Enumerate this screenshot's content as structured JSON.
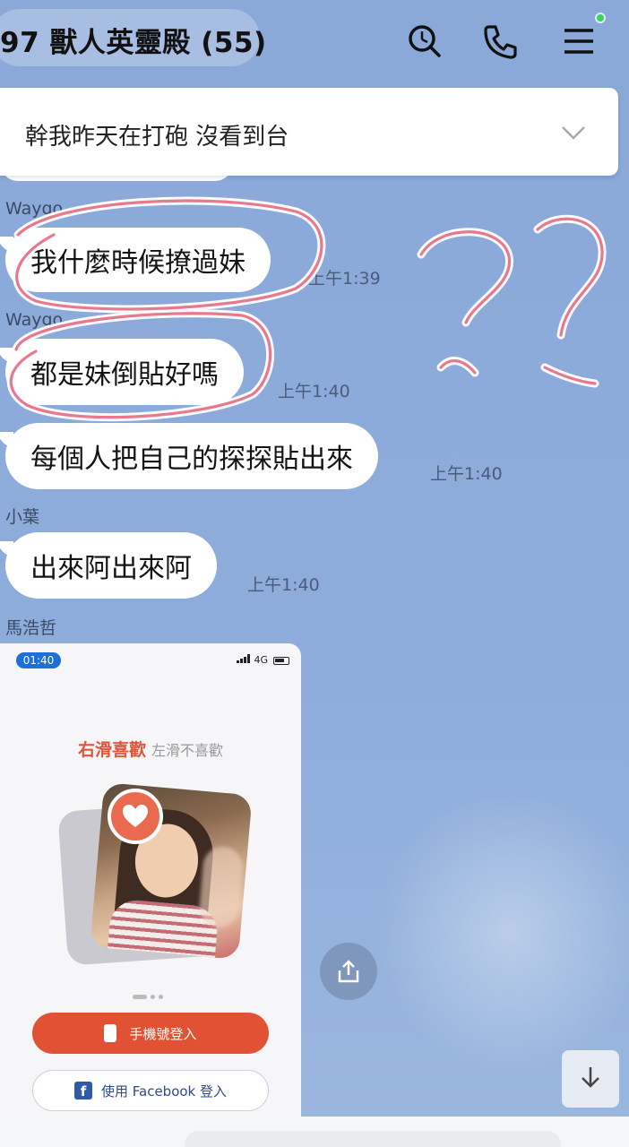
{
  "header": {
    "title": "97 獸人英靈殿 (55)",
    "icons": [
      "search-icon",
      "phone-icon",
      "menu-icon"
    ]
  },
  "announcement": {
    "text": "幹我昨天在打砲 沒看到台"
  },
  "messages": [
    {
      "sender": "Waygo",
      "text": "我什麼時候撩過妹",
      "time": "上午1:39"
    },
    {
      "sender": "Waygo",
      "text": "都是妹倒貼好嗎",
      "time": "上午1:40"
    },
    {
      "sender": "",
      "text": "每個人把自己的探探貼出來",
      "time": "上午1:40"
    },
    {
      "sender": "小葉",
      "text": "出來阿出來阿",
      "time": "上午1:40"
    },
    {
      "sender": "馬浩哲",
      "text": "",
      "time": ""
    }
  ],
  "shared_image": {
    "status_time": "01:40",
    "status_right": "4G",
    "swipe_like": "右滑喜歡",
    "swipe_dislike": "左滑不喜歡",
    "phone_login": "手機號登入",
    "facebook_login": "使用 Facebook 登入"
  },
  "annotation": {
    "marks": "??",
    "color": "#e8798c"
  },
  "colors": {
    "background": "#8eabd9",
    "bubble": "#ffffff",
    "accent_red": "#e05233",
    "facebook_blue": "#2f5aa8"
  }
}
